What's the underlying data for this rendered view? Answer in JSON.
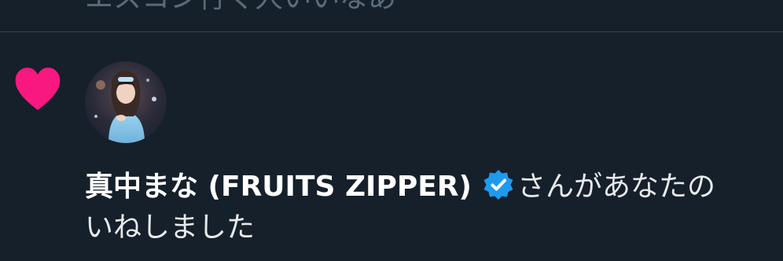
{
  "previous_tweet": {
    "text": "エスコン行く人いいなあ"
  },
  "notification": {
    "icon": "heart-icon",
    "icon_color": "#f91880",
    "avatar": "user-avatar",
    "username": "真中まな (FRUITS ZIPPER)",
    "verified_color": "#1d9bf0",
    "action_text_1": "さんがあなたの",
    "action_text_2": "いねしました"
  }
}
